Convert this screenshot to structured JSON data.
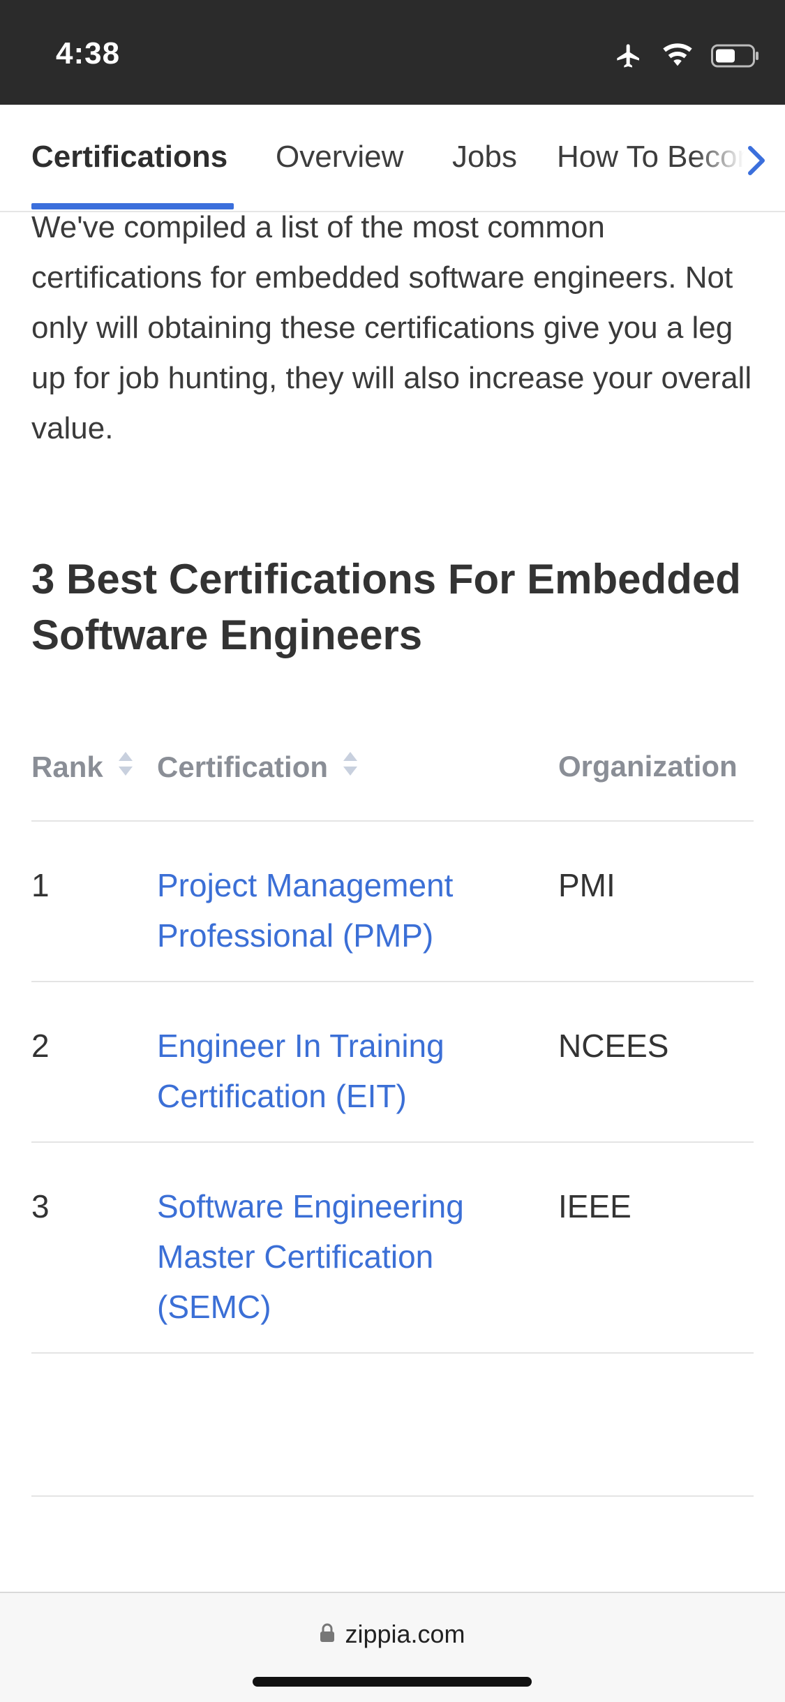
{
  "status_bar": {
    "time": "4:38",
    "icons": [
      "airplane-icon",
      "wifi-icon",
      "battery-icon"
    ]
  },
  "tabs": [
    {
      "label": "Certifications",
      "active": true
    },
    {
      "label": "Overview",
      "active": false
    },
    {
      "label": "Jobs",
      "active": false
    },
    {
      "label": "How To Become",
      "active": false
    }
  ],
  "intro_text": "We've compiled a list of the most common certifications for embedded software engineers. Not only will obtaining these certifications give you a leg up for job hunting, they will also increase your overall value.",
  "section_title": "3 Best Certifications For Embedded Software Engineers",
  "table": {
    "headers": {
      "rank": "Rank",
      "certification": "Certification",
      "organization": "Organization"
    },
    "rows": [
      {
        "rank": "1",
        "certification": "Project Management Professional (PMP)",
        "organization": "PMI"
      },
      {
        "rank": "2",
        "certification": "Engineer In Training Certification (EIT)",
        "organization": "NCEES"
      },
      {
        "rank": "3",
        "certification": "Software Engineering Master Certification (SEMC)",
        "organization": "IEEE"
      }
    ]
  },
  "browser": {
    "url": "zippia.com"
  },
  "colors": {
    "accent": "#3b6fdc",
    "link": "#3b6fd6",
    "status_bar": "#2b2b2b"
  }
}
